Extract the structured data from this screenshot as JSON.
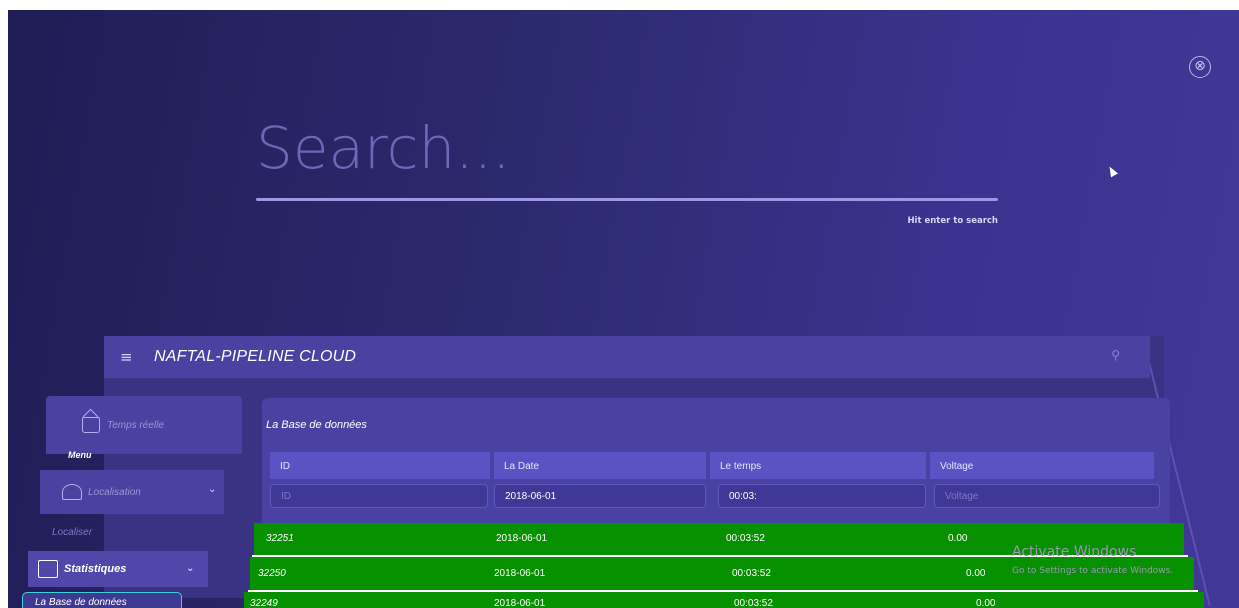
{
  "overlay": {
    "close_icon": "⊗",
    "search": {
      "placeholder": "Search...",
      "hint": "Hit enter to search"
    }
  },
  "app": {
    "menu_icon": "≡",
    "title": "NAFTAL-PIPELINE CLOUD",
    "search_icon": "⚲"
  },
  "sidebar": {
    "menu_label": "Menu",
    "items": [
      {
        "label": "Temps réelle",
        "icon": "home-icon"
      },
      {
        "label": "Localisation",
        "icon": "map-icon",
        "chevron": "⌄"
      },
      {
        "label": "Localiser"
      },
      {
        "label": "Statistiques",
        "icon": "stats-icon",
        "chevron": "⌄"
      },
      {
        "label": "La Base de données"
      }
    ]
  },
  "panel": {
    "title": "La Base de données",
    "columns": [
      "ID",
      "La Date",
      "Le temps",
      "Voltage"
    ],
    "filters": [
      {
        "value": "",
        "placeholder": "ID"
      },
      {
        "value": "2018-06-01",
        "placeholder": ""
      },
      {
        "value": "00:03:",
        "placeholder": ""
      },
      {
        "value": "",
        "placeholder": "Voltage"
      }
    ],
    "rows": [
      [
        "32251",
        "2018-06-01",
        "00:03:52",
        "0.00"
      ],
      [
        "32250",
        "2018-06-01",
        "00:03:52",
        "0.00"
      ],
      [
        "32249",
        "2018-06-01",
        "00:03:52",
        "0.00"
      ]
    ],
    "row_color": "#079000"
  },
  "watermark": {
    "line1": "Activate Windows",
    "line2": "Go to Settings to activate Windows."
  }
}
